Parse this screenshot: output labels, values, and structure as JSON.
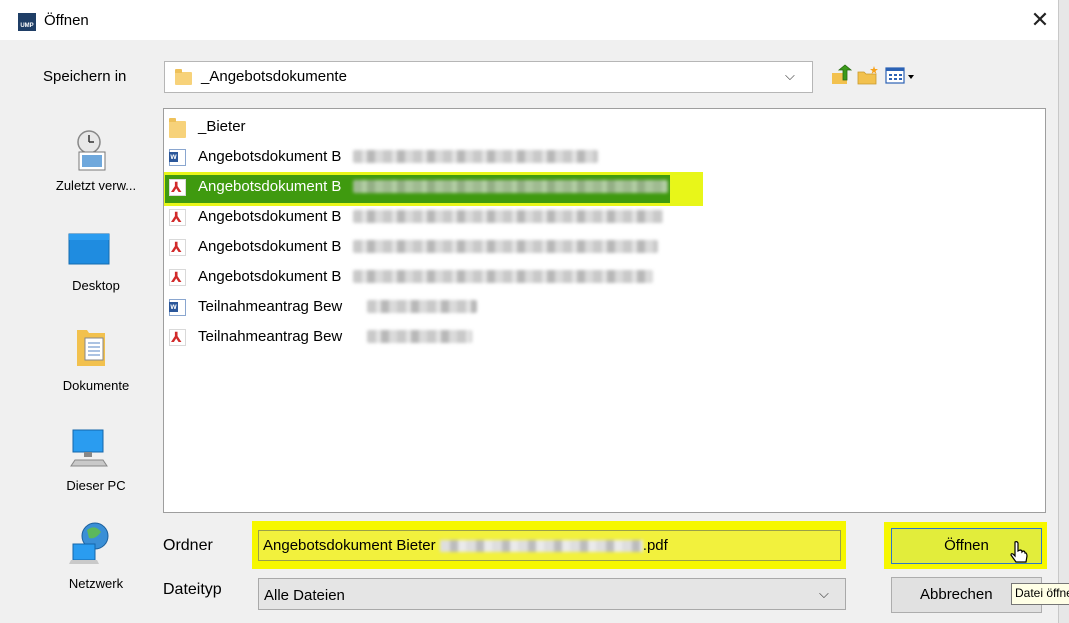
{
  "window": {
    "title": "Öffnen",
    "app_icon_text": "UMP",
    "close_glyph": "✕"
  },
  "lookin": {
    "label": "Speichern in",
    "value": "_Angebotsdokumente",
    "arrow": "⌵"
  },
  "toolbar": {
    "up_icon": "up-folder-icon",
    "new_folder_icon": "new-folder-icon",
    "view_icon": "view-menu-icon"
  },
  "places": [
    {
      "label": "Zuletzt verw...",
      "icon": "recent-icon"
    },
    {
      "label": "Desktop",
      "icon": "desktop-icon"
    },
    {
      "label": "Dokumente",
      "icon": "documents-icon"
    },
    {
      "label": "Dieser PC",
      "icon": "computer-icon"
    },
    {
      "label": "Netzwerk",
      "icon": "network-icon"
    }
  ],
  "files": [
    {
      "name": "_Bieter",
      "type": "folder"
    },
    {
      "name": "Angebotsdokument B",
      "type": "word"
    },
    {
      "name": "Angebotsdokument B",
      "type": "pdf",
      "selected": true
    },
    {
      "name": "Angebotsdokument B",
      "type": "pdf"
    },
    {
      "name": "Angebotsdokument B",
      "type": "pdf"
    },
    {
      "name": "Angebotsdokument B",
      "type": "pdf"
    },
    {
      "name": "Teilnahmeantrag Bew",
      "type": "word"
    },
    {
      "name": "Teilnahmeantrag Bew",
      "type": "pdf"
    }
  ],
  "filename": {
    "label": "Ordner",
    "value_prefix": "Angebotsdokument Bieter",
    "value_suffix": ".pdf"
  },
  "filetype": {
    "label": "Dateityp",
    "value": "Alle Dateien",
    "arrow": "⌵"
  },
  "buttons": {
    "open": "Öffnen",
    "cancel": "Abbrechen"
  },
  "tooltip": "Datei öffnen",
  "colors": {
    "highlight": "#f6f700",
    "selection": "#3f9a0f",
    "accent": "#2f77c9"
  }
}
